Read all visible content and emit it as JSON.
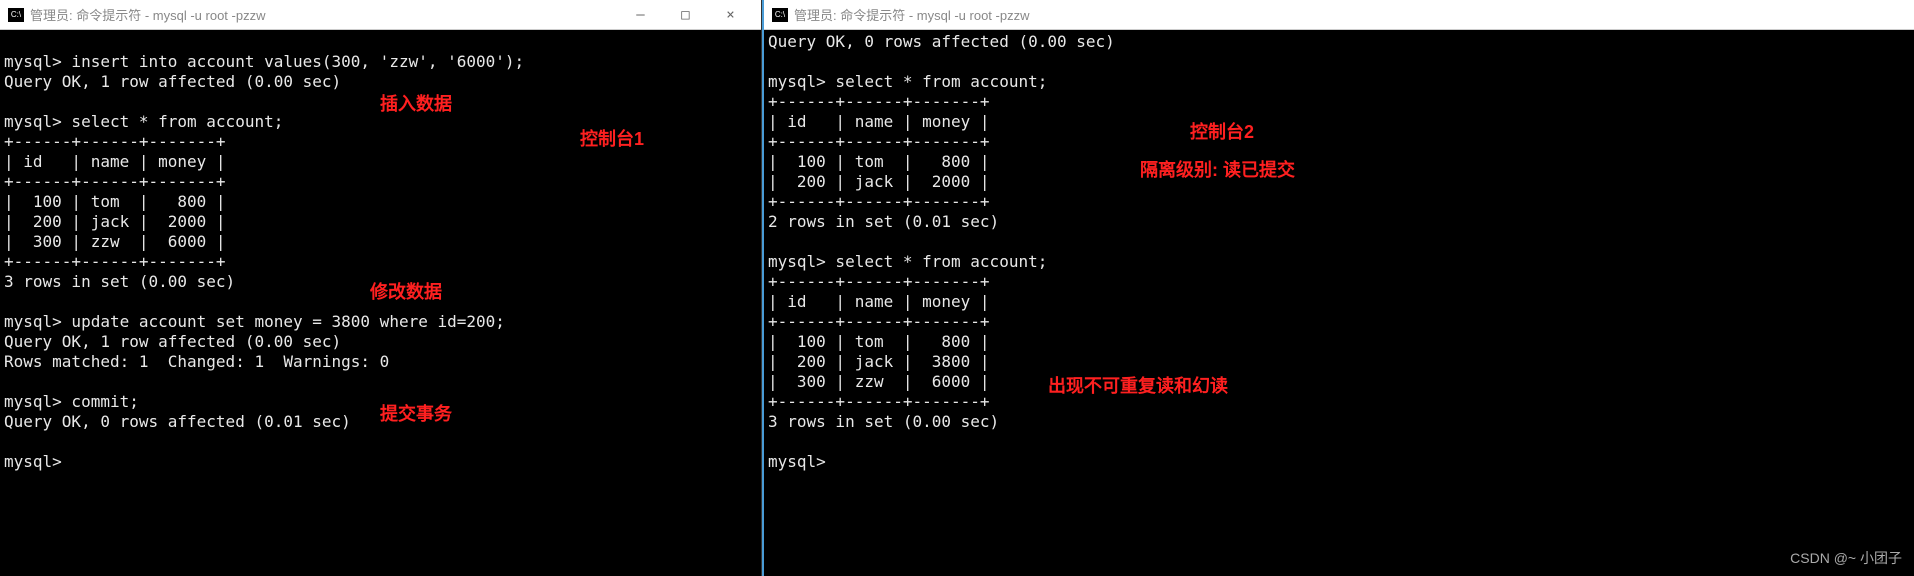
{
  "watermark": "CSDN @~ 小团子",
  "left": {
    "title": "管理员: 命令提示符 - mysql  -u root -pzzw",
    "controls": {
      "min": "—",
      "max": "□",
      "close": "×"
    },
    "lines": [
      "",
      "mysql> insert into account values(300, 'zzw', '6000');",
      "Query OK, 1 row affected (0.00 sec)",
      "",
      "mysql> select * from account;",
      "+------+------+-------+",
      "| id   | name | money |",
      "+------+------+-------+",
      "|  100 | tom  |   800 |",
      "|  200 | jack |  2000 |",
      "|  300 | zzw  |  6000 |",
      "+------+------+-------+",
      "3 rows in set (0.00 sec)",
      "",
      "mysql> update account set money = 3800 where id=200;",
      "Query OK, 1 row affected (0.00 sec)",
      "Rows matched: 1  Changed: 1  Warnings: 0",
      "",
      "mysql> commit;",
      "Query OK, 0 rows affected (0.01 sec)",
      "",
      "mysql>"
    ]
  },
  "right": {
    "title": "管理员: 命令提示符 - mysql  -u root -pzzw",
    "lines": [
      "Query OK, 0 rows affected (0.00 sec)",
      "",
      "mysql> select * from account;",
      "+------+------+-------+",
      "| id   | name | money |",
      "+------+------+-------+",
      "|  100 | tom  |   800 |",
      "|  200 | jack |  2000 |",
      "+------+------+-------+",
      "2 rows in set (0.01 sec)",
      "",
      "mysql> select * from account;",
      "+------+------+-------+",
      "| id   | name | money |",
      "+------+------+-------+",
      "|  100 | tom  |   800 |",
      "|  200 | jack |  3800 |",
      "|  300 | zzw  |  6000 |",
      "+------+------+-------+",
      "3 rows in set (0.00 sec)",
      "",
      "mysql>"
    ]
  },
  "annotations": {
    "a1": "插入数据",
    "a2": "控制台1",
    "a3": "修改数据",
    "a4": "提交事务",
    "a5": "控制台2",
    "a6": "隔离级别: 读已提交",
    "a7": "出现不可重复读和幻读"
  },
  "chart_data": {
    "type": "table",
    "description": "MySQL isolation level demo — read committed showing non-repeatable read and phantom read",
    "left_console": {
      "insert_row": {
        "id": 300,
        "name": "zzw",
        "money": 6000
      },
      "select_after_insert": [
        {
          "id": 100,
          "name": "tom",
          "money": 800
        },
        {
          "id": 200,
          "name": "jack",
          "money": 2000
        },
        {
          "id": 300,
          "name": "zzw",
          "money": 6000
        }
      ],
      "update": {
        "id": 200,
        "money": 3800
      },
      "commit": true
    },
    "right_console": {
      "isolation_level": "读已提交 (READ COMMITTED)",
      "select_before_commit": [
        {
          "id": 100,
          "name": "tom",
          "money": 800
        },
        {
          "id": 200,
          "name": "jack",
          "money": 2000
        }
      ],
      "select_after_commit": [
        {
          "id": 100,
          "name": "tom",
          "money": 800
        },
        {
          "id": 200,
          "name": "jack",
          "money": 3800
        },
        {
          "id": 300,
          "name": "zzw",
          "money": 6000
        }
      ]
    }
  }
}
